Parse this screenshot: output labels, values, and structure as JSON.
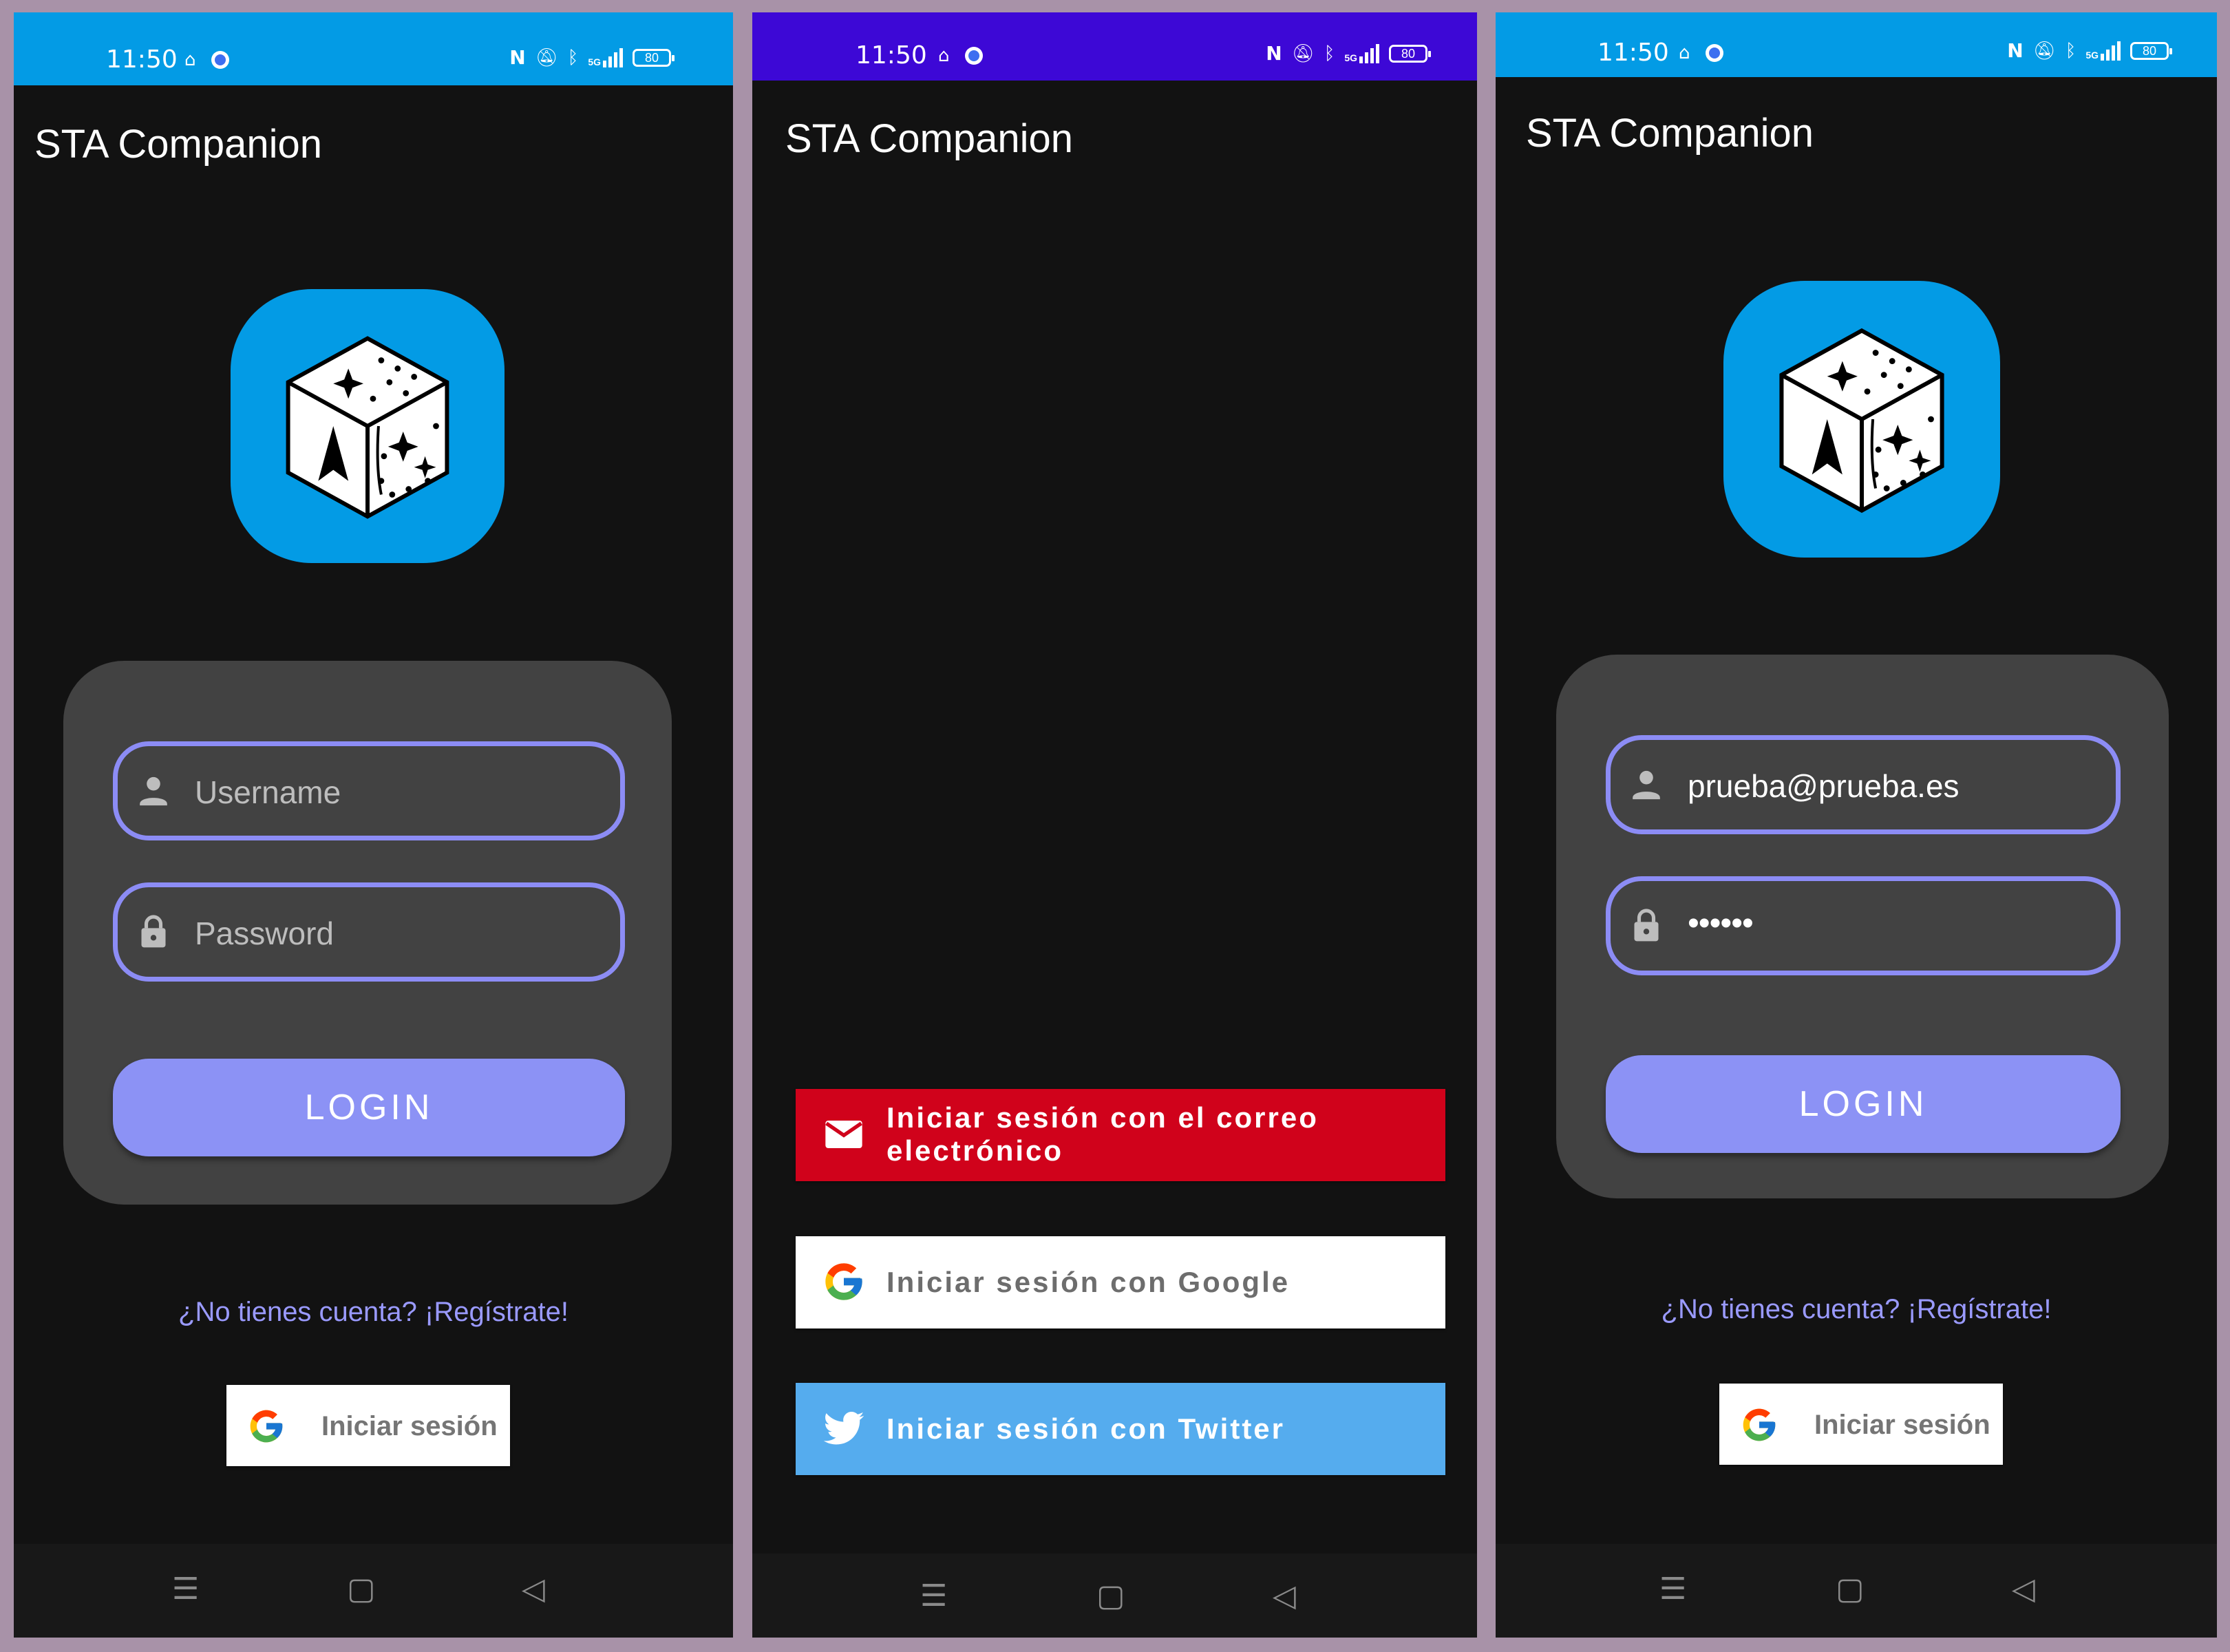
{
  "status_bar": {
    "time": "11:50",
    "battery": "80",
    "signal": "5G"
  },
  "app": {
    "title": "STA Companion"
  },
  "login_form": {
    "username_placeholder": "Username",
    "password_placeholder": "Password",
    "login_label": "LOGIN",
    "register_link": "¿No tienes cuenta? ¡Regístrate!",
    "google_signin_label": "Iniciar sesión"
  },
  "login_form_filled": {
    "username_value": "prueba@prueba.es",
    "password_value": "••••••",
    "login_label": "LOGIN",
    "register_link": "¿No tienes cuenta? ¡Regístrate!",
    "google_signin_label": "Iniciar sesión"
  },
  "providers": [
    {
      "name": "email",
      "label": "Iniciar sesión con el correo electrónico",
      "color": "#d0021b"
    },
    {
      "name": "google",
      "label": "Iniciar sesión con Google",
      "color": "#ffffff"
    },
    {
      "name": "twitter",
      "label": "Iniciar sesión con Twitter",
      "color": "#55acee"
    }
  ],
  "colors": {
    "status_bar": "#039be5",
    "status_bar_alt": "#3d08d6",
    "accent": "#8c92f5",
    "background": "#121212",
    "card": "#424242",
    "link": "#9a9aff"
  },
  "icons": [
    "home-icon",
    "app-badge-icon",
    "nfc-icon",
    "mute-icon",
    "bluetooth-icon",
    "signal-icon",
    "battery-icon",
    "person-icon",
    "lock-icon",
    "google-g-icon",
    "mail-icon",
    "twitter-bird-icon",
    "menu-icon",
    "square-icon",
    "back-icon"
  ]
}
